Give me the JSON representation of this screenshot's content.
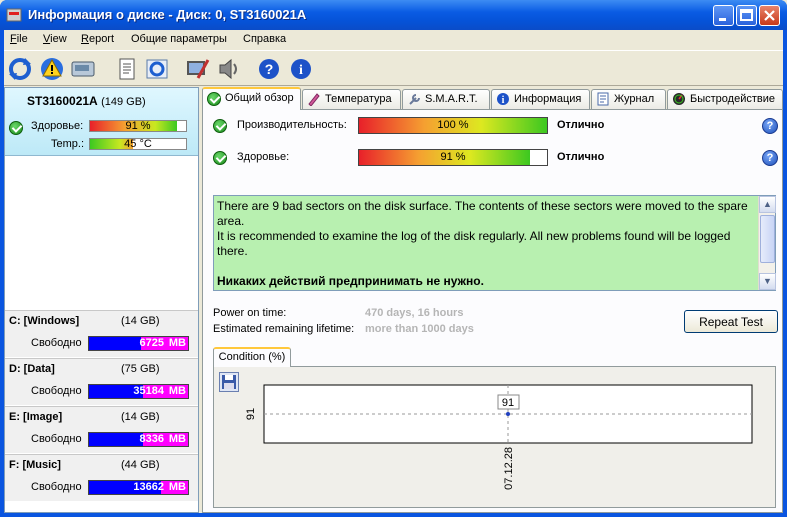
{
  "window": {
    "title": "Информация о диске - Диск: 0, ST3160021A"
  },
  "menu": {
    "items": [
      {
        "label": "File",
        "key": "F",
        "rest": "ile"
      },
      {
        "label": "View",
        "key": "V",
        "rest": "iew"
      },
      {
        "label": "Report",
        "key": "R",
        "rest": "eport"
      },
      {
        "label": "Общие параметры",
        "key": "",
        "rest": "Общие параметры"
      },
      {
        "label": "Справка",
        "key": "",
        "rest": "Справка"
      }
    ]
  },
  "toolbar": {
    "icons": [
      "refresh-icon",
      "warning-icon",
      "disk-icon",
      "report-icon",
      "refresh-all-icon",
      "settings-icon",
      "sound-icon",
      "help-icon",
      "info-icon"
    ]
  },
  "disk": {
    "name": "ST3160021A",
    "size": "(149 GB)",
    "health_label": "Здоровье:",
    "health_value": "91 %",
    "health_fraction": 0.91,
    "temp_label": "Temp.:",
    "temp_value": "45 °C",
    "temp_fraction": 0.45
  },
  "volumes": [
    {
      "name": "C: [Windows]",
      "size": "(14 GB)",
      "free_label": "Свободно",
      "free_value": "6725",
      "unit": "MB",
      "used_fraction": 0.53
    },
    {
      "name": "D: [Data]",
      "size": "(75 GB)",
      "free_label": "Свободно",
      "free_value": "35184",
      "unit": "MB",
      "used_fraction": 0.55
    },
    {
      "name": "E: [Image]",
      "size": "(14 GB)",
      "free_label": "Свободно",
      "free_value": "8336",
      "unit": "MB",
      "used_fraction": 0.55
    },
    {
      "name": "F: [Music]",
      "size": "(44 GB)",
      "free_label": "Свободно",
      "free_value": "13662",
      "unit": "MB",
      "used_fraction": 0.73
    }
  ],
  "tabs": [
    {
      "label": "Общий обзор",
      "icon": "check-icon",
      "active": true
    },
    {
      "label": "Температура",
      "icon": "thermometer-icon",
      "active": false
    },
    {
      "label": "S.M.A.R.T.",
      "icon": "wrench-icon",
      "active": false
    },
    {
      "label": "Информация",
      "icon": "info-icon",
      "active": false
    },
    {
      "label": "Журнал",
      "icon": "log-icon",
      "active": false
    },
    {
      "label": "Быстродействие",
      "icon": "speedometer-icon",
      "active": false
    }
  ],
  "overview": {
    "performance_label": "Производительность:",
    "performance_value": "100 %",
    "performance_fraction": 1.0,
    "performance_status": "Отлично",
    "health_label": "Здоровье:",
    "health_value": "91 %",
    "health_fraction": 0.91,
    "health_status": "Отлично",
    "message_lines": [
      "There are 9 bad sectors on the disk surface. The contents of these sectors were moved to the spare area.",
      "It is recommended to examine the log of the disk regularly. All new problems found will be logged there.",
      "",
      "Никаких действий предпринимать не нужно."
    ],
    "power_on_label": "Power on time:",
    "power_on_value": "470 days, 16 hours",
    "lifetime_label": "Estimated remaining lifetime:",
    "lifetime_value": "more than 1000 days",
    "repeat_test_label": "Repeat Test"
  },
  "condition_tab": {
    "label": "Condition (%)"
  },
  "chart_data": {
    "type": "line",
    "title": "",
    "x": [
      "07.12.28"
    ],
    "series": [
      {
        "values": [
          91
        ]
      }
    ],
    "ytick": "91",
    "point_label": "91",
    "grid": true
  },
  "colors": {
    "status_box": "#b8f0b0",
    "free_space": "#ff00ff",
    "used_space": "#0000ff",
    "title_bar": "#0a5ce4"
  }
}
